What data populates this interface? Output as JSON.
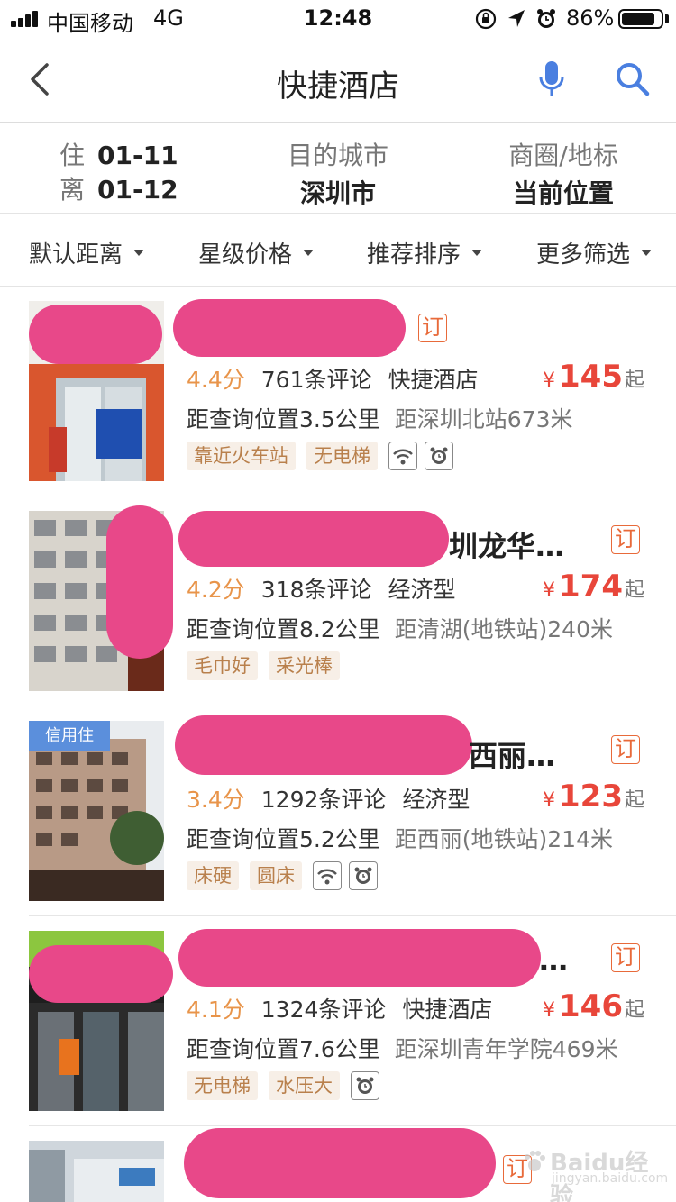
{
  "status_bar": {
    "carrier": "中国移动",
    "network": "4G",
    "time": "12:48",
    "battery": "86%",
    "battery_level": 0.86,
    "icons": [
      "orientation-lock-icon",
      "location-arrow-icon",
      "alarm-icon"
    ]
  },
  "nav": {
    "title": "快捷酒店",
    "back_icon": "chevron-left-icon",
    "voice_icon": "microphone-icon",
    "search_icon": "search-icon"
  },
  "info": {
    "checkin_label": "住",
    "checkin_date": "01-11",
    "checkout_label": "离",
    "checkout_date": "01-12",
    "city_label": "目的城市",
    "city_value": "深圳市",
    "landmark_label": "商圈/地标",
    "landmark_value": "当前位置"
  },
  "filters": [
    "默认距离",
    "星级价格",
    "推荐排序",
    "更多筛选"
  ],
  "colors": {
    "accent_blue": "#4a7fe0",
    "price_red": "#e8463a",
    "score_orange": "#e8944a",
    "tag_bg": "#f7efe7",
    "tag_text": "#b9804c",
    "redaction": "#e84889"
  },
  "hotels": [
    {
      "name_visible": "",
      "book": "订",
      "score": "4.4分",
      "reviews": "761条评论",
      "type": "快捷酒店",
      "price_currency": "¥",
      "price": "145",
      "price_suffix": "起",
      "distance": "距查询位置3.5公里",
      "nearby": "距深圳北站673米",
      "tags": [
        "靠近火车站",
        "无电梯"
      ],
      "icons": [
        "wifi-icon",
        "alarm-clock-icon"
      ]
    },
    {
      "name_visible": "圳龙华…",
      "book": "订",
      "score": "4.2分",
      "reviews": "318条评论",
      "type": "经济型",
      "price_currency": "¥",
      "price": "174",
      "price_suffix": "起",
      "distance": "距查询位置8.2公里",
      "nearby": "距清湖(地铁站)240米",
      "tags": [
        "毛巾好",
        "采光棒"
      ],
      "icons": []
    },
    {
      "badge": "信用住",
      "name_visible": "西丽…",
      "book": "订",
      "score": "3.4分",
      "reviews": "1292条评论",
      "type": "经济型",
      "price_currency": "¥",
      "price": "123",
      "price_suffix": "起",
      "distance": "距查询位置5.2公里",
      "nearby": "距西丽(地铁站)214米",
      "tags": [
        "床硬",
        "圆床"
      ],
      "icons": [
        "wifi-icon",
        "alarm-clock-icon"
      ]
    },
    {
      "name_visible": "…",
      "book": "订",
      "score": "4.1分",
      "reviews": "1324条评论",
      "type": "快捷酒店",
      "price_currency": "¥",
      "price": "146",
      "price_suffix": "起",
      "distance": "距查询位置7.6公里",
      "nearby": "距深圳青年学院469米",
      "tags": [
        "无电梯",
        "水压大"
      ],
      "icons": [
        "alarm-clock-icon"
      ]
    },
    {
      "book": "订"
    }
  ],
  "watermark": {
    "text": "Baidu经验",
    "sub": "jingyan.baidu.com"
  }
}
